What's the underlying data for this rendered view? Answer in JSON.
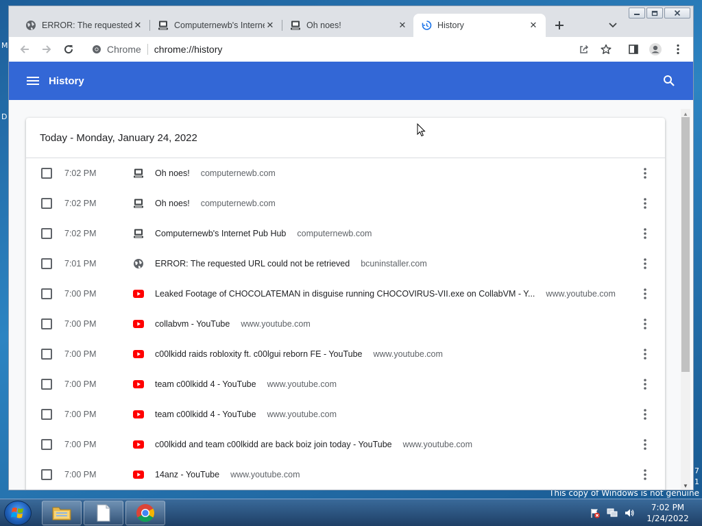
{
  "desktop": {
    "left_fragments": [
      "M",
      "D"
    ],
    "right_fragments": [
      "7",
      "1"
    ],
    "watermark": "This copy of Windows is not genuine"
  },
  "browser": {
    "tabs": [
      {
        "title": "ERROR: The requested U",
        "icon": "globe-icon",
        "close": "✕"
      },
      {
        "title": "Computernewb's Interne",
        "icon": "computer-icon",
        "close": "✕"
      },
      {
        "title": "Oh noes!",
        "icon": "computer-icon",
        "close": "✕"
      },
      {
        "title": "History",
        "icon": "history-icon",
        "close": "✕",
        "active": true
      }
    ],
    "omnibox": {
      "label": "Chrome",
      "url": "chrome://history"
    }
  },
  "history_page": {
    "title": "History",
    "colors": {
      "appbar": "#3367d6",
      "youtube": "#ff0000"
    },
    "date_header": "Today - Monday, January 24, 2022",
    "entries": [
      {
        "time": "7:02 PM",
        "title": "Oh noes!",
        "domain": "computernewb.com",
        "icon": "computer-icon"
      },
      {
        "time": "7:02 PM",
        "title": "Oh noes!",
        "domain": "computernewb.com",
        "icon": "computer-icon"
      },
      {
        "time": "7:02 PM",
        "title": "Computernewb's Internet Pub Hub",
        "domain": "computernewb.com",
        "icon": "computer-icon"
      },
      {
        "time": "7:01 PM",
        "title": "ERROR: The requested URL could not be retrieved",
        "domain": "bcuninstaller.com",
        "icon": "globe-icon"
      },
      {
        "time": "7:00 PM",
        "title": "Leaked Footage of CHOCOLATEMAN in disguise running CHOCOVIRUS-VII.exe on CollabVM - Y...",
        "domain": "www.youtube.com",
        "icon": "youtube-icon"
      },
      {
        "time": "7:00 PM",
        "title": "collabvm - YouTube",
        "domain": "www.youtube.com",
        "icon": "youtube-icon"
      },
      {
        "time": "7:00 PM",
        "title": "c00lkidd raids robloxity ft. c00lgui reborn FE - YouTube",
        "domain": "www.youtube.com",
        "icon": "youtube-icon"
      },
      {
        "time": "7:00 PM",
        "title": "team c00lkidd 4 - YouTube",
        "domain": "www.youtube.com",
        "icon": "youtube-icon"
      },
      {
        "time": "7:00 PM",
        "title": "team c00lkidd 4 - YouTube",
        "domain": "www.youtube.com",
        "icon": "youtube-icon"
      },
      {
        "time": "7:00 PM",
        "title": "c00lkidd and team c00lkidd are back boiz join today - YouTube",
        "domain": "www.youtube.com",
        "icon": "youtube-icon"
      },
      {
        "time": "7:00 PM",
        "title": "14anz - YouTube",
        "domain": "www.youtube.com",
        "icon": "youtube-icon"
      }
    ]
  },
  "taskbar": {
    "items": [
      "explorer-icon",
      "document-icon",
      "chrome-icon"
    ],
    "clock": {
      "time": "7:02 PM",
      "date": "1/24/2022"
    }
  }
}
